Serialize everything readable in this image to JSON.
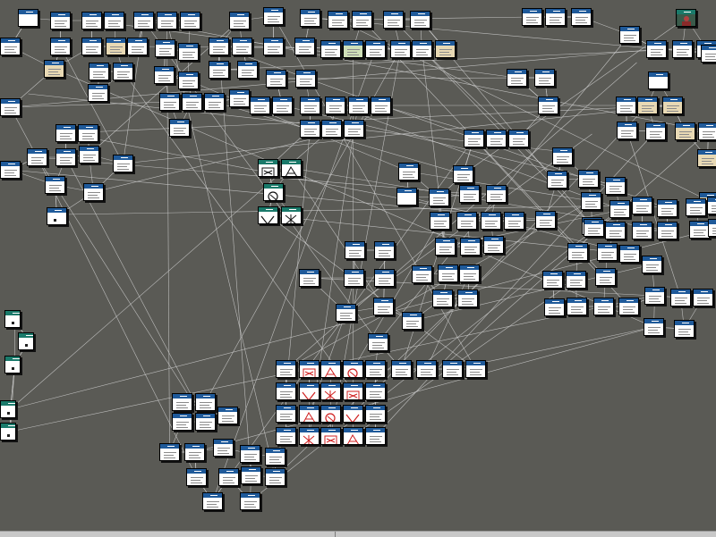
{
  "app": {
    "canvas_background": "#5a5a55",
    "wire_color": "#cfcfcf",
    "node_header_color": "#1f5a9a",
    "node_header_alt_color": "#1a7a6a"
  },
  "node_kinds": {
    "default": "document-node-icon",
    "tan": "tan-document-node-icon",
    "green": "green-document-node-icon",
    "blank": "blank-node-icon",
    "dot": "dot-node-icon",
    "teal-image": "image-node-icon",
    "red-image": "red-image-node-icon"
  },
  "statusbar": {
    "left_text": "",
    "right_text": ""
  }
}
